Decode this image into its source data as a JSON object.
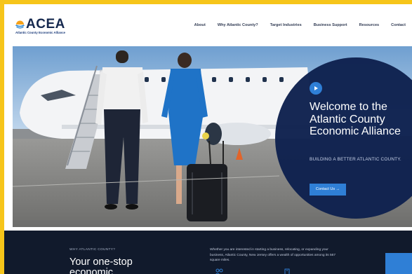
{
  "brand": {
    "name": "ACEA",
    "tagline": "Atlantic County Economic Alliance"
  },
  "nav": {
    "items": [
      "About",
      "Why Atlantic County?",
      "Target Industries",
      "Business Support",
      "Resources",
      "Contact"
    ]
  },
  "hero": {
    "title": "Welcome to the Atlantic County Economic Alliance",
    "subtitle": "BUILDING A BETTER ATLANTIC COUNTY.",
    "cta_label": "Contact Us →",
    "icon_names": [
      "play-icon",
      "airplane-photo"
    ]
  },
  "why": {
    "label": "WHY ATLANTIC COUNTY?",
    "heading": "Your one-stop economic",
    "body": "Whether you are interested in starting a business, relocating, or expanding your business, Atlantic County, New Jersey offers a wealth of opportunities among its 567 square miles."
  },
  "colors": {
    "frame": "#f6c51a",
    "navy": "#0e214e",
    "accent": "#2f7fd6",
    "dark_band": "#111a2c"
  }
}
